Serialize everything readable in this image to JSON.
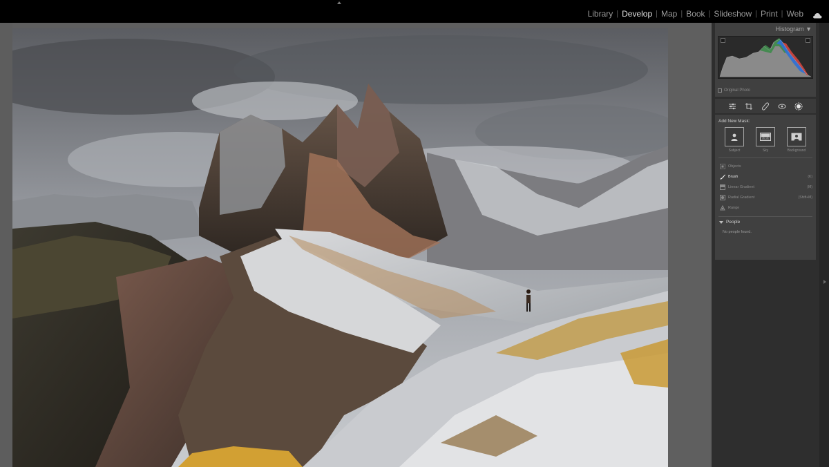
{
  "modules": {
    "items": [
      {
        "label": "Library",
        "active": false
      },
      {
        "label": "Develop",
        "active": true
      },
      {
        "label": "Map",
        "active": false
      },
      {
        "label": "Book",
        "active": false
      },
      {
        "label": "Slideshow",
        "active": false
      },
      {
        "label": "Print",
        "active": false
      },
      {
        "label": "Web",
        "active": false
      }
    ],
    "cloud_icon": "cloud-icon"
  },
  "histogram": {
    "title": "Histogram ▼",
    "original_photo_label": "Original Photo",
    "original_photo_checked": false
  },
  "tools": {
    "icons": [
      "edit-sliders-icon",
      "crop-icon",
      "healing-icon",
      "redeye-icon",
      "masking-icon"
    ],
    "active": "masking-icon"
  },
  "masking": {
    "add_new_mask_label": "Add New Mask:",
    "quick_masks": [
      {
        "label": "Subject",
        "icon": "subject-icon"
      },
      {
        "label": "Sky",
        "icon": "sky-icon"
      },
      {
        "label": "Background",
        "icon": "background-icon"
      }
    ],
    "tools": [
      {
        "label": "Objects",
        "shortcut": "",
        "icon": "objects-icon",
        "active": false
      },
      {
        "label": "Brush",
        "shortcut": "(K)",
        "icon": "brush-icon",
        "active": true
      },
      {
        "label": "Linear Gradient",
        "shortcut": "(M)",
        "icon": "linear-gradient-icon",
        "active": false
      },
      {
        "label": "Radial Gradient",
        "shortcut": "(Shift+M)",
        "icon": "radial-gradient-icon",
        "active": false
      },
      {
        "label": "Range",
        "shortcut": "",
        "icon": "range-icon",
        "active": false
      }
    ],
    "people_heading": "People",
    "people_empty": "No people found."
  },
  "colors": {
    "topbar": "#000000",
    "panel": "#404040",
    "active_module": "#e6e6e6",
    "inactive_module": "#9a9a9a"
  }
}
